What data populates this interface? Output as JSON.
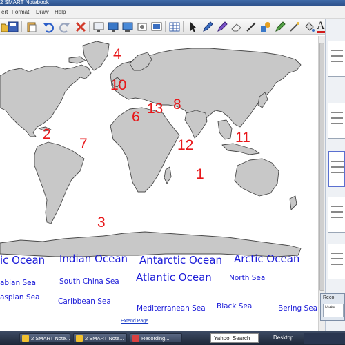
{
  "window": {
    "title": "2 SMART Notebook"
  },
  "menu": [
    {
      "label": "ert"
    },
    {
      "label": "Format"
    },
    {
      "label": "Draw"
    },
    {
      "label": "Help"
    }
  ],
  "toolbar": {
    "icons": [
      "open-icon",
      "save-icon",
      "paste-icon",
      "undo-icon",
      "redo-icon",
      "delete-icon",
      "screen-shade-icon",
      "full-screen-icon",
      "display-icon",
      "capture-icon",
      "document-camera-icon",
      "table-icon",
      "select-icon",
      "pen-icon",
      "creative-pen-icon",
      "eraser-icon",
      "line-icon",
      "shapes-icon",
      "fill-icon",
      "magic-pen-icon",
      "text-icon"
    ],
    "text_tool_label": "A"
  },
  "map": {
    "land_color": "#c8c8c8",
    "outline_color": "#4a4a4a",
    "numbers": [
      "4",
      "10",
      "8",
      "6",
      "13",
      "2",
      "7",
      "11",
      "12",
      "1",
      "3"
    ]
  },
  "labels": {
    "ocean_partial": "ic Ocean",
    "indian_ocean": "Indian Ocean",
    "antarctic_ocean": "Antarctic Ocean",
    "arctic_ocean": "Arctic Ocean",
    "atlantic_ocean": "Atlantic Ocean",
    "arabian_sea": "abian Sea",
    "south_china_sea": "South China Sea",
    "north_sea": "North Sea",
    "caspian_sea": "aspian Sea",
    "caribbean_sea": "Caribbean Sea",
    "mediterranean_sea": "Mediterranean Sea",
    "black_sea": "Black Sea",
    "bering_sea": "Bering Sea"
  },
  "colors": {
    "number": "#e8171a",
    "label": "#1b1bd8"
  },
  "extend_page": "Extend Page",
  "recorder": {
    "title": "Reco",
    "body": "Make..."
  },
  "taskbar": {
    "notebook": "2 SMART Note...",
    "recording": "Recording...",
    "yahoo_search": "Yahoo! Search",
    "desktop": "Desktop"
  }
}
